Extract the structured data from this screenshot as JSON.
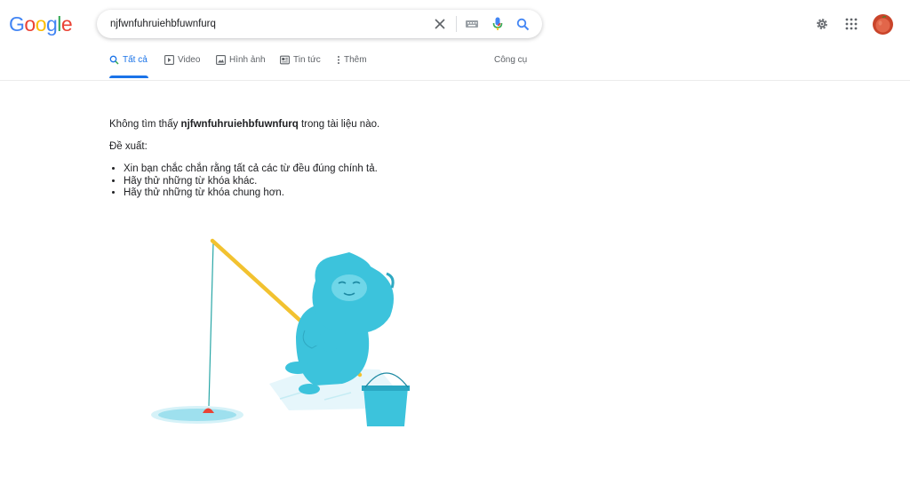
{
  "logo": {
    "text": "Google",
    "letters": [
      "G",
      "o",
      "o",
      "g",
      "l",
      "e"
    ],
    "colors": [
      "#4285f4",
      "#ea4335",
      "#fbbc05",
      "#4285f4",
      "#34a853",
      "#ea4335"
    ]
  },
  "search": {
    "query": "njfwnfuhruiehbfuwnfurq"
  },
  "header_icons": [
    "clear-icon",
    "keyboard-icon",
    "microphone-icon",
    "search-icon",
    "settings-icon",
    "apps-icon",
    "avatar"
  ],
  "tabs": [
    {
      "label": "Tất cả",
      "icon": "search-icon",
      "active": true
    },
    {
      "label": "Video",
      "icon": "play-icon",
      "active": false
    },
    {
      "label": "Hình ảnh",
      "icon": "image-icon",
      "active": false
    },
    {
      "label": "Tin tức",
      "icon": "news-icon",
      "active": false
    },
    {
      "label": "Thêm",
      "icon": "more-vert-icon",
      "active": false
    }
  ],
  "tools_label": "Công cụ",
  "results": {
    "no_result_prefix": "Không tìm thấy ",
    "query_bold": "njfwnfuhruiehbfuwnfurq",
    "no_result_suffix": " trong tài liệu nào.",
    "suggestions_title": "Đề xuất:",
    "suggestions": [
      "Xin bạn chắc chắn rằng tất cả các từ đều đúng chính tả.",
      "Hãy thử những từ khóa khác.",
      "Hãy thử những từ khóa chung hơn."
    ]
  },
  "colors": {
    "accent": "#1a73e8",
    "text": "#202124",
    "muted": "#5f6368",
    "monster": "#3cc3dc",
    "rod": "#f2c230",
    "bobber": "#ea4335"
  }
}
